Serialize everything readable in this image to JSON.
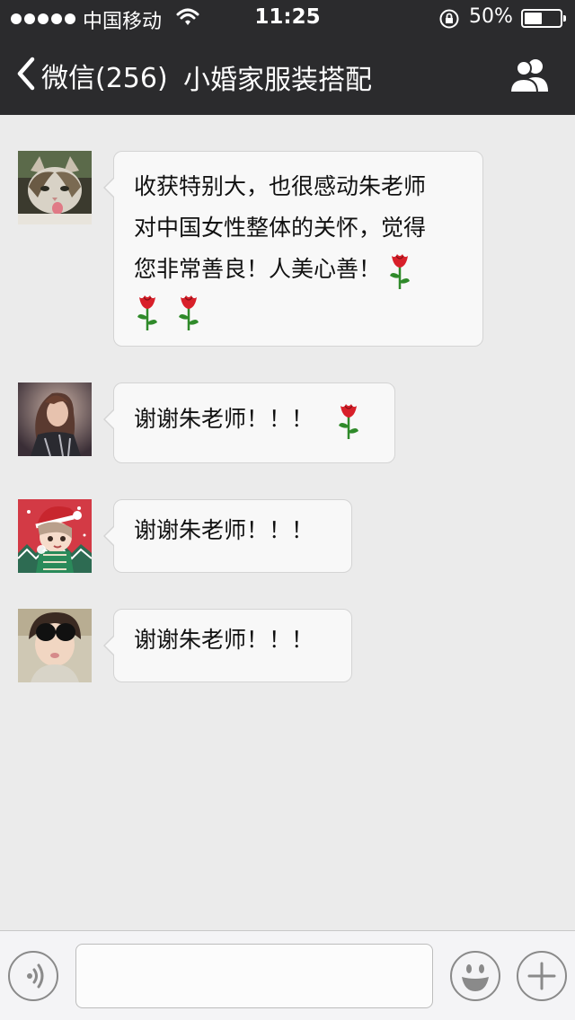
{
  "status_bar": {
    "carrier": "中国移动",
    "time": "11:25",
    "battery_percent": "50%",
    "battery_level": 0.5,
    "signal_dots": 5
  },
  "nav": {
    "back_label": "微信(256)",
    "title": "小婚家服装搭配",
    "icons": {
      "back": "chevron-left-icon",
      "members": "people-icon"
    }
  },
  "messages": [
    {
      "lines": [
        "收获特别大，也很感动朱老师",
        "对中国女性整体的关怀，觉得",
        "您非常善良！人美心善！"
      ],
      "emoji": "rose",
      "rose_count": 3,
      "avatar": "cat-avatar"
    },
    {
      "text": "谢谢朱老师！！！",
      "emoji": "rose",
      "rose_count": 1,
      "avatar": "woman-avatar"
    },
    {
      "text": "谢谢朱老师！！！",
      "rose_count": 0,
      "avatar": "cartoon-avatar"
    },
    {
      "text": "谢谢朱老师！！！",
      "rose_count": 0,
      "avatar": "sunglasses-avatar"
    }
  ],
  "input_bar": {
    "text_value": "",
    "icons": {
      "voice": "voice-icon",
      "emoji": "smiley-icon",
      "more": "plus-icon"
    }
  },
  "colors": {
    "bar_dark": "#2b2b2d",
    "chat_background": "#ebebeb",
    "bubble": "#f8f8f8",
    "rose_red": "#d8202a",
    "stem_green": "#2f8a2a"
  }
}
